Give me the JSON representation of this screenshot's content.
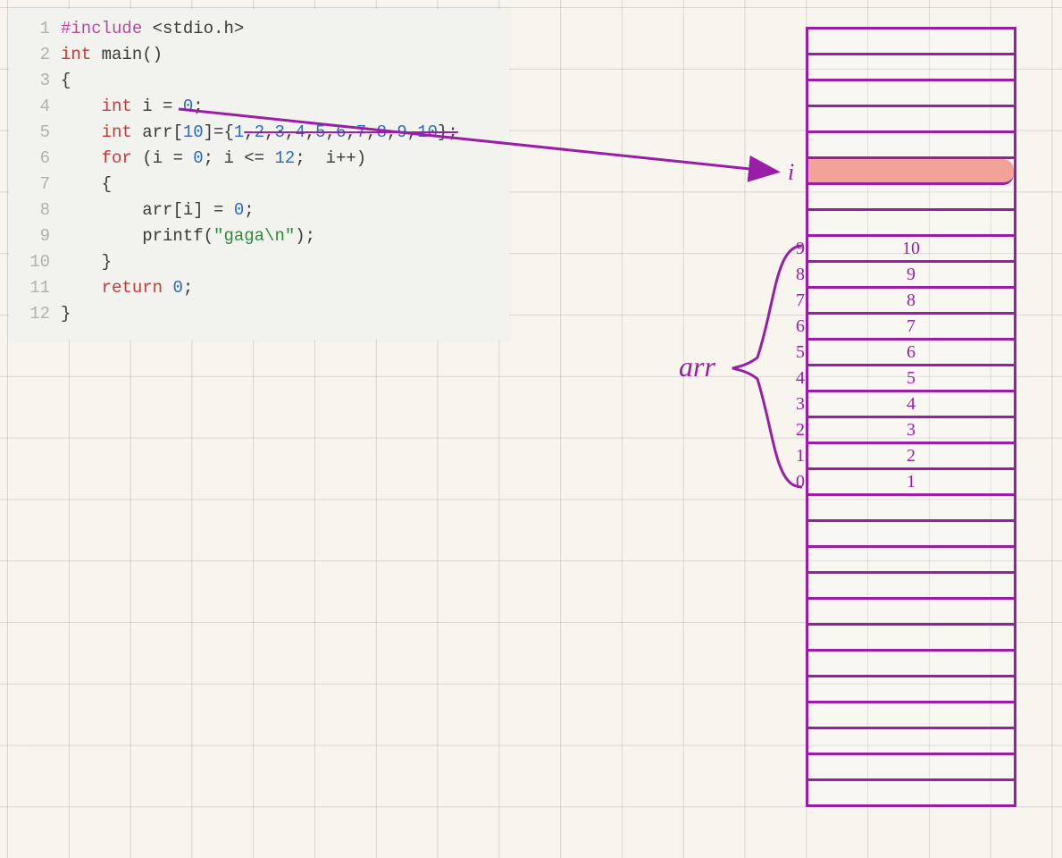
{
  "code": {
    "lines": [
      {
        "n": "1",
        "tokens": [
          [
            "pp",
            "#include "
          ],
          [
            "inc",
            "<stdio.h>"
          ]
        ]
      },
      {
        "n": "2",
        "tokens": [
          [
            "type",
            "int "
          ],
          [
            "id",
            "main"
          ],
          [
            "op",
            "()"
          ]
        ]
      },
      {
        "n": "3",
        "tokens": [
          [
            "op",
            "{"
          ]
        ]
      },
      {
        "n": "4",
        "indent": "    ",
        "tokens": [
          [
            "type",
            "int "
          ],
          [
            "id",
            "i "
          ],
          [
            "op",
            "= "
          ],
          [
            "num",
            "0"
          ],
          [
            "op",
            ";"
          ]
        ]
      },
      {
        "n": "5",
        "indent": "    ",
        "tokens": [
          [
            "type",
            "int "
          ],
          [
            "id",
            "arr"
          ],
          [
            "op",
            "["
          ],
          [
            "num",
            "10"
          ],
          [
            "op",
            "]={"
          ],
          [
            "num",
            "1"
          ],
          [
            "op",
            ","
          ],
          [
            "num",
            "2"
          ],
          [
            "op",
            ","
          ],
          [
            "num",
            "3"
          ],
          [
            "op",
            ","
          ],
          [
            "num",
            "4"
          ],
          [
            "op",
            ","
          ],
          [
            "num",
            "5"
          ],
          [
            "op",
            ","
          ],
          [
            "num",
            "6"
          ],
          [
            "op",
            ","
          ],
          [
            "num",
            "7"
          ],
          [
            "op",
            ","
          ],
          [
            "num",
            "8"
          ],
          [
            "op",
            ","
          ],
          [
            "num",
            "9"
          ],
          [
            "op",
            ","
          ],
          [
            "num",
            "10"
          ],
          [
            "op",
            "};"
          ]
        ],
        "strike_from": 6
      },
      {
        "n": "6",
        "indent": "    ",
        "tokens": [
          [
            "kw",
            "for "
          ],
          [
            "op",
            "("
          ],
          [
            "id",
            "i "
          ],
          [
            "op",
            "= "
          ],
          [
            "num",
            "0"
          ],
          [
            "op",
            "; "
          ],
          [
            "id",
            "i "
          ],
          [
            "op",
            "<= "
          ],
          [
            "num",
            "12"
          ],
          [
            "op",
            ";  "
          ],
          [
            "id",
            "i"
          ],
          [
            "op",
            "++)"
          ]
        ]
      },
      {
        "n": "7",
        "indent": "    ",
        "tokens": [
          [
            "op",
            "{"
          ]
        ]
      },
      {
        "n": "8",
        "indent": "        ",
        "tokens": [
          [
            "id",
            "arr"
          ],
          [
            "op",
            "["
          ],
          [
            "id",
            "i"
          ],
          [
            "op",
            "] = "
          ],
          [
            "num",
            "0"
          ],
          [
            "op",
            ";"
          ]
        ]
      },
      {
        "n": "9",
        "indent": "        ",
        "tokens": [
          [
            "id",
            "printf"
          ],
          [
            "op",
            "("
          ],
          [
            "str",
            "\"gaga\\n\""
          ],
          [
            "op",
            ");"
          ]
        ]
      },
      {
        "n": "10",
        "indent": "    ",
        "tokens": [
          [
            "op",
            "}"
          ]
        ]
      },
      {
        "n": "11",
        "indent": "    ",
        "tokens": [
          [
            "kw",
            "return "
          ],
          [
            "num",
            "0"
          ],
          [
            "op",
            ";"
          ]
        ]
      },
      {
        "n": "12",
        "tokens": [
          [
            "op",
            "}"
          ]
        ]
      }
    ]
  },
  "labels": {
    "i": "i",
    "arr": "arr"
  },
  "memory": {
    "total_cells": 30,
    "highlight_index": 5,
    "arr_start": 8,
    "arr_values": [
      {
        "idx": "9",
        "val": "10"
      },
      {
        "idx": "8",
        "val": "9"
      },
      {
        "idx": "7",
        "val": "8"
      },
      {
        "idx": "6",
        "val": "7"
      },
      {
        "idx": "5",
        "val": "6"
      },
      {
        "idx": "4",
        "val": "5"
      },
      {
        "idx": "3",
        "val": "4"
      },
      {
        "idx": "2",
        "val": "3"
      },
      {
        "idx": "1",
        "val": "2"
      },
      {
        "idx": "0",
        "val": "1"
      }
    ]
  }
}
